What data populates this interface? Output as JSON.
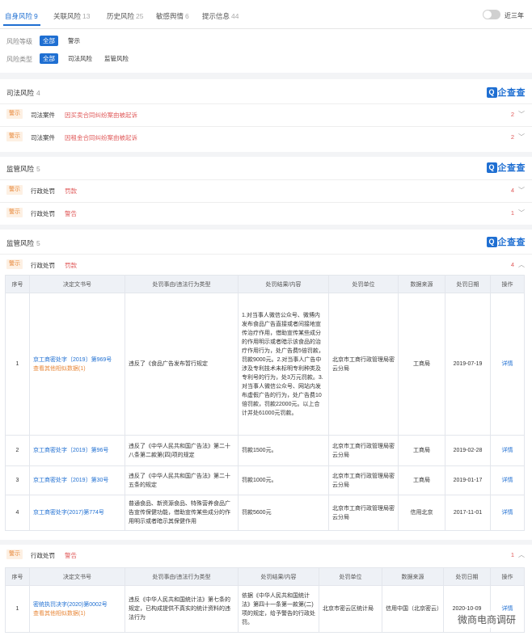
{
  "tabs": [
    {
      "label": "自身风险",
      "count": "9",
      "active": true
    },
    {
      "label": "关联风险",
      "count": "13",
      "active": false
    },
    {
      "label": "历史风险",
      "count": "25",
      "active": false
    },
    {
      "label": "敏感舆情",
      "count": "6",
      "active": false
    },
    {
      "label": "提示信息",
      "count": "44",
      "active": false
    }
  ],
  "toggle_label": "近三年",
  "filters": {
    "level_label": "风险等级",
    "level_options": [
      "全部",
      "警示"
    ],
    "type_label": "风险类型",
    "type_options": [
      "全部",
      "司法风险",
      "监管风险"
    ]
  },
  "judicial": {
    "title": "司法风险",
    "count": "4",
    "logo_text": "企查查",
    "rows": [
      {
        "tag": "警示",
        "type": "司法案件",
        "reason": "因买卖合同纠纷案由被起诉",
        "count": "2"
      },
      {
        "tag": "警示",
        "type": "司法案件",
        "reason": "因租金合同纠纷案由被起诉",
        "count": "2"
      }
    ]
  },
  "regulatory1": {
    "title": "监管风险",
    "count": "5",
    "logo_text": "企查查",
    "rows": [
      {
        "tag": "警示",
        "type": "行政处罚",
        "reason": "罚款",
        "count": "4"
      },
      {
        "tag": "警示",
        "type": "行政处罚",
        "reason": "警告",
        "count": "1"
      }
    ]
  },
  "regulatory2": {
    "title": "监管风险",
    "count": "5",
    "logo_text": "企查查",
    "row": {
      "tag": "警示",
      "type": "行政处罚",
      "reason": "罚款",
      "count": "4"
    },
    "headers": [
      "序号",
      "决定文书号",
      "处罚事由/违法行为类型",
      "处罚结果/内容",
      "处罚单位",
      "数据来源",
      "处罚日期",
      "操作"
    ],
    "rows": [
      {
        "no": "1",
        "doc": "京工商密处字〔2019〕第969号",
        "more": "查看其他相似数据(1)",
        "reason": "违反了《食品广告发布暂行规定",
        "result": "1.对当事人微信公众号、微博内发布食品广告直接或者间接地宣传治疗作用，借助宣传某些成分的作用明示或者暗示该食品的治疗作用行为，处广告费5倍罚款，罚款9000元。2.对当事人广告中涉及专利技术未标明专利种类及专利号的行为，处3万元罚款。3.对当事人微信公众号、网站内发布虚假广告的行为，处广告费10倍罚款，罚款22000元。以上合计并处61000元罚款。",
        "unit": "北京市工商行政管理局密云分局",
        "source": "工商局",
        "date": "2019-07-19",
        "action": "详情"
      },
      {
        "no": "2",
        "doc": "京工商密处字〔2019〕第96号",
        "more": "",
        "reason": "违反了《中华人民共和国广告法》第二十八条第二款第(四)项的规定",
        "result": "罚款1500元。",
        "unit": "北京市工商行政管理局密云分局",
        "source": "工商局",
        "date": "2019-02-28",
        "action": "详情"
      },
      {
        "no": "3",
        "doc": "京工商密处字〔2019〕第30号",
        "more": "",
        "reason": "违反了《中华人民共和国广告法》第二十五条的规定",
        "result": "罚款1000元。",
        "unit": "北京市工商行政管理局密云分局",
        "source": "工商局",
        "date": "2019-01-17",
        "action": "详情"
      },
      {
        "no": "4",
        "doc": "京工商密处字(2017)第774号",
        "more": "",
        "reason": "普通食品、新资源食品、特殊营养食品广告宣传保健功能，借助宣传某些成分的作用明示或者暗示其保健作用",
        "result": "罚款5600元",
        "unit": "北京市工商行政管理局密云分局",
        "source": "信用北京",
        "date": "2017-11-01",
        "action": "详情"
      }
    ]
  },
  "warning": {
    "row": {
      "tag": "警示",
      "type": "行政处罚",
      "reason": "警告",
      "count": "1"
    },
    "headers": [
      "序号",
      "决定文书号",
      "处罚事由/违法行为类型",
      "处罚结果/内容",
      "处罚单位",
      "数据来源",
      "处罚日期",
      "操作"
    ],
    "rows": [
      {
        "no": "1",
        "doc": "密统执罚决字(2020)第0002号",
        "more": "查看其他相似数据(1)",
        "reason": "违反《中华人民共和国统计法》第七条的规定，已构成提供不真实的统计资料的违法行为",
        "result": "依据《中华人民共和国统计法》第四十一条第一款第(二)项的规定，给予警告的行政处罚。",
        "unit": "北京市密云区统计局",
        "source": "信用中国（北京密云）",
        "date": "2020-10-09",
        "action": "详情"
      }
    ]
  },
  "watermark": "微商电商调研"
}
